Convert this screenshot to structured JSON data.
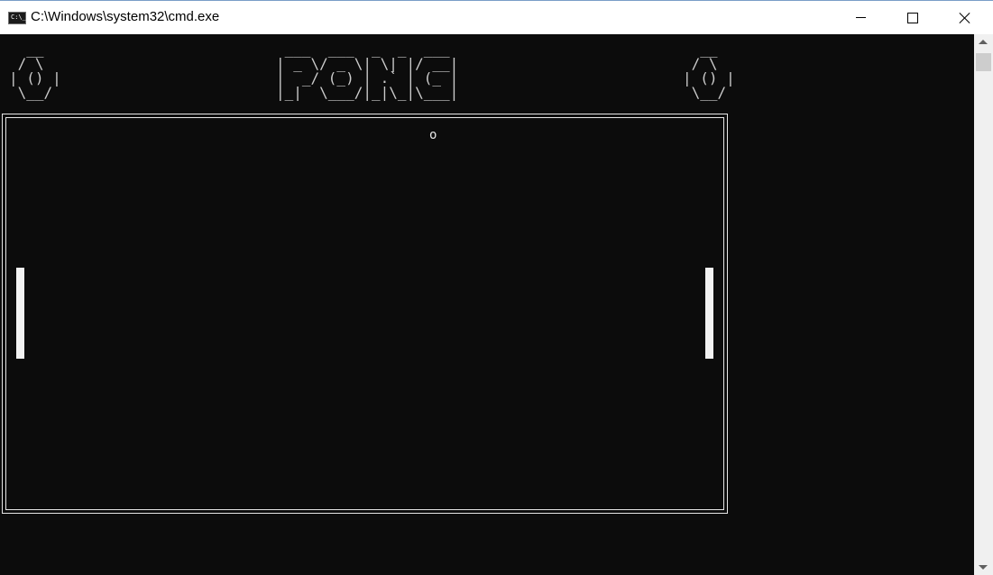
{
  "window": {
    "title": "C:\\Windows\\system32\\cmd.exe",
    "icon": "console-icon",
    "icon_text": "C:\\_"
  },
  "game": {
    "left_score_ascii": "  __\n / \\\n| () |\n \\__/",
    "logo_ascii": " ___  ___  _  _  ___\n| _ \\/ _ \\| \\| |/ __|\n|  _/ (_) | .` | (_ |\n|_|  \\___/|_|\\_|\\___|",
    "right_score_ascii": "  __\n / \\\n| () |\n \\__/",
    "ball": "o",
    "left_score": 0,
    "right_score": 0
  },
  "colors": {
    "console_background": "#0c0c0c",
    "foreground": "#cccccc",
    "paddle": "#f2f2f2",
    "titlebar": "#ffffff"
  }
}
